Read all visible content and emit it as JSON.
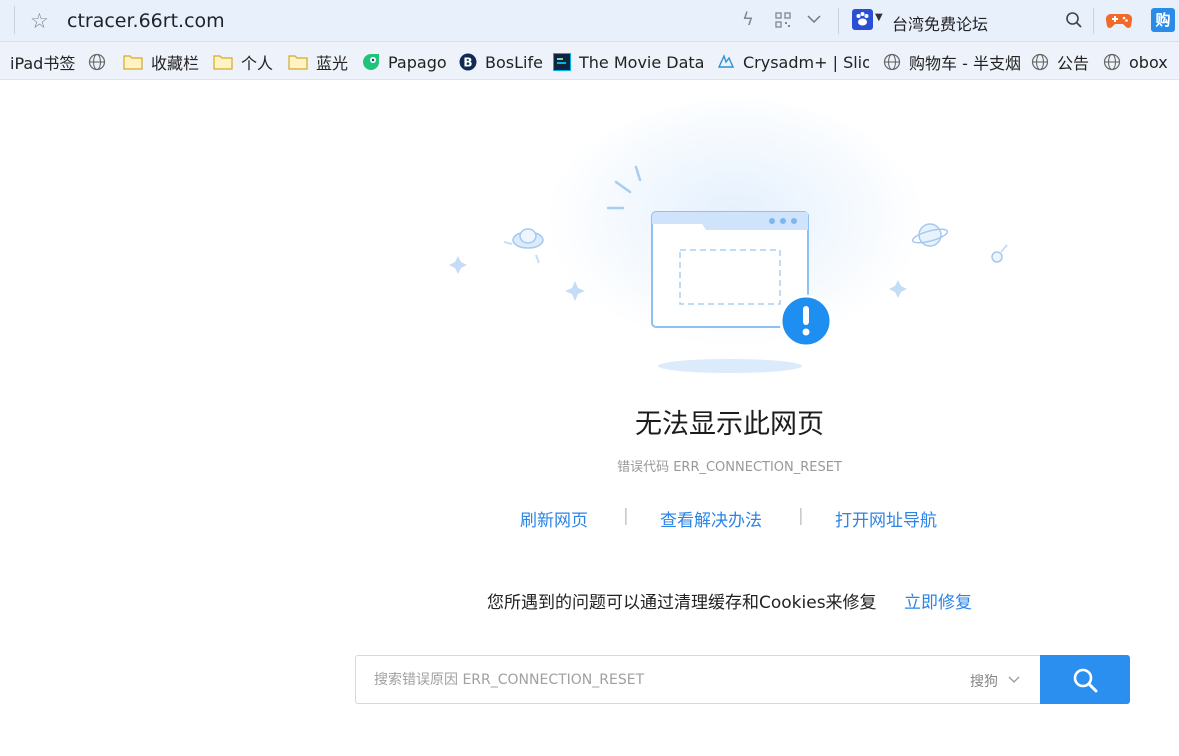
{
  "address_bar": {
    "url": "ctracer.66rt.com",
    "search_label": "台湾免费论坛"
  },
  "bookmarks": [
    {
      "label": "iPad书签",
      "icon": "none"
    },
    {
      "label": "",
      "icon": "globe-icon"
    },
    {
      "label": "收藏栏",
      "icon": "folder-icon"
    },
    {
      "label": "个人",
      "icon": "folder-icon"
    },
    {
      "label": "蓝光",
      "icon": "folder-icon"
    },
    {
      "label": "Papago",
      "icon": "papago-icon"
    },
    {
      "label": "BosLife",
      "icon": "boslife-icon"
    },
    {
      "label": "The Movie Datab",
      "icon": "tmdb-icon"
    },
    {
      "label": "Crysadm+ | Slio",
      "icon": "crysadm-icon"
    },
    {
      "label": "购物车 - 半支烟",
      "icon": "globe-icon"
    },
    {
      "label": "公告",
      "icon": "globe-icon"
    },
    {
      "label": "obox",
      "icon": "globe-icon"
    }
  ],
  "error": {
    "title": "无法显示此网页",
    "code": "错误代码 ERR_CONNECTION_RESET",
    "actions": [
      "刷新网页",
      "查看解决办法",
      "打开网址导航"
    ],
    "separator": "|",
    "hint": "您所遇到的问题可以通过清理缓存和Cookies来修复",
    "fix_link": "立即修复"
  },
  "search": {
    "placeholder": "搜索错误原因 ERR_CONNECTION_RESET",
    "engine": "搜狗"
  },
  "colors": {
    "accent": "#2b8ff0",
    "link": "#2c84e6",
    "toolbar_bg": "#e8f0fb"
  }
}
